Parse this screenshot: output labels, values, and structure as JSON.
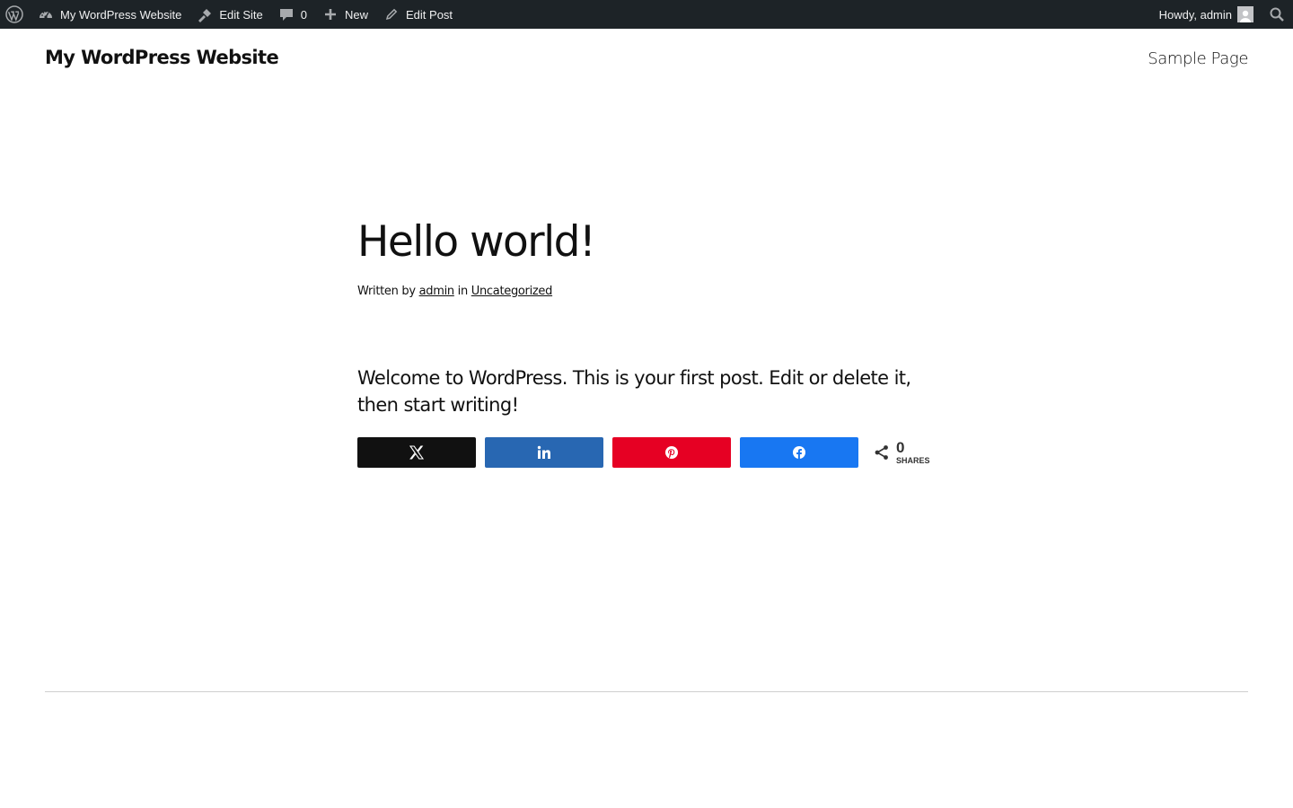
{
  "admin_bar": {
    "site_name": "My WordPress Website",
    "edit_site": "Edit Site",
    "comments_count": "0",
    "new_label": "New",
    "edit_post": "Edit Post",
    "howdy": "Howdy, admin",
    "icons": [
      "wordpress-logo-icon",
      "dashboard-icon",
      "edit-site-icon",
      "comment-icon",
      "plus-icon",
      "pencil-icon",
      "avatar",
      "search-icon"
    ]
  },
  "header": {
    "site_title": "My WordPress Website",
    "nav": [
      "Sample Page"
    ]
  },
  "post": {
    "title": "Hello world!",
    "meta_written_by": "Written by",
    "author": "admin",
    "meta_in": "in",
    "category": "Uncategorized",
    "body": "Welcome to WordPress. This is your first post. Edit or delete it, then start writing!"
  },
  "share": {
    "buttons": [
      {
        "network": "x",
        "icon": "x-icon",
        "color": "#111111"
      },
      {
        "network": "linkedin",
        "icon": "linkedin-icon",
        "color": "#2867b2"
      },
      {
        "network": "pinterest",
        "icon": "pinterest-icon",
        "color": "#e60023"
      },
      {
        "network": "facebook",
        "icon": "facebook-icon",
        "color": "#1877f2"
      }
    ],
    "count": "0",
    "count_label": "SHARES"
  },
  "colors": {
    "admin_bar_bg": "#1d2327",
    "admin_bar_text": "#f0f0f1",
    "text": "#111111",
    "divider": "#cfcfcf"
  }
}
